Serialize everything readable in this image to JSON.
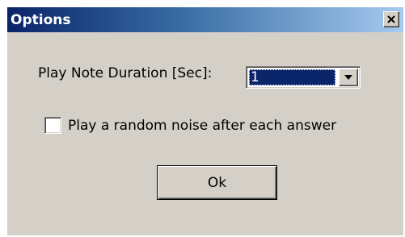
{
  "window": {
    "title": "Options",
    "close_icon": "close-icon"
  },
  "settings": {
    "duration_label": "Play Note Duration [Sec]:",
    "duration_value": "1",
    "duration_dropdown_icon": "chevron-down-icon",
    "noise_label": "Play a random noise after each answer",
    "noise_checked": false
  },
  "actions": {
    "ok_label": "Ok"
  },
  "colors": {
    "title_bar_start": "#0a246a",
    "title_bar_end": "#a6caf0",
    "dialog_background": "#d4d0c8",
    "selection_background": "#0a246a"
  }
}
